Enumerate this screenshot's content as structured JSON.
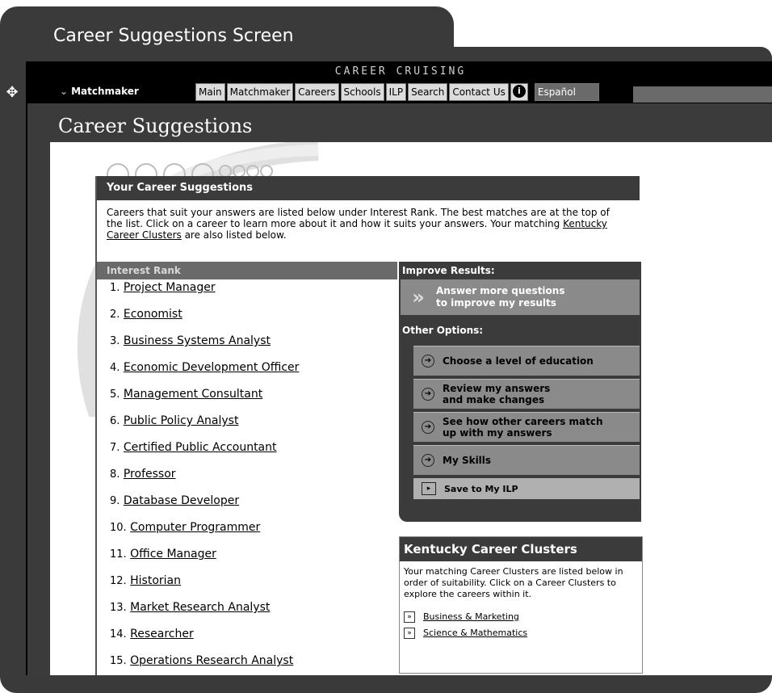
{
  "caption": "Career Suggestions Screen",
  "app": {
    "brand": "CAREER CRUISING",
    "section": "Matchmaker",
    "menu": [
      "Main",
      "Matchmaker",
      "Careers",
      "Schools",
      "ILP",
      "Search",
      "Contact Us"
    ],
    "language": "Español",
    "info_icon": "i"
  },
  "page_title": "Career Suggestions",
  "card": {
    "title": "Your Career Suggestions",
    "intro_pre": "Careers that suit your answers are listed below under Interest Rank. The best matches are at the top of the list. Click on a career to learn more about it and how it suits your answers.  Your matching ",
    "intro_link": "Kentucky Career Clusters",
    "intro_post": " are also listed below."
  },
  "rank": {
    "header": "Interest Rank",
    "items": [
      {
        "num": "1.",
        "label": "Project Manager"
      },
      {
        "num": "2.",
        "label": "Economist"
      },
      {
        "num": "3.",
        "label": "Business Systems Analyst"
      },
      {
        "num": "4.",
        "label": "Economic Development Officer"
      },
      {
        "num": "5.",
        "label": "Management Consultant"
      },
      {
        "num": "6.",
        "label": "Public Policy Analyst"
      },
      {
        "num": "7.",
        "label": "Certified Public Accountant"
      },
      {
        "num": "8.",
        "label": "Professor"
      },
      {
        "num": "9.",
        "label": "Database Developer"
      },
      {
        "num": "10.",
        "label": "Computer Programmer"
      },
      {
        "num": "11.",
        "label": "Office Manager"
      },
      {
        "num": "12.",
        "label": "Historian"
      },
      {
        "num": "13.",
        "label": "Market Research Analyst"
      },
      {
        "num": "14.",
        "label": "Researcher"
      },
      {
        "num": "15.",
        "label": "Operations Research Analyst"
      }
    ]
  },
  "sidebar": {
    "improve_label": "Improve Results:",
    "improve_btn_line1": "Answer more questions",
    "improve_btn_line2": "to improve my results",
    "other_label": "Other Options:",
    "options": [
      {
        "line1": "Choose a level of education",
        "line2": ""
      },
      {
        "line1": "Review my answers",
        "line2": "and make changes"
      },
      {
        "line1": "See how other careers match",
        "line2": "up with my answers"
      },
      {
        "line1": "My Skills",
        "line2": ""
      }
    ],
    "save_label": "Save to My ILP"
  },
  "clusters": {
    "title": "Kentucky Career Clusters",
    "description": "Your matching Career Clusters are listed below in order of suitability. Click on a Career Clusters to explore the careers within it.",
    "items": [
      "Business & Marketing",
      "Science & Mathematics"
    ]
  },
  "icons": {
    "move": "move-arrows-icon",
    "section": "double-chevron-down-icon",
    "improve": "double-chevron-right-icon",
    "option": "circle-arrow-right-icon",
    "save": "folder-icon",
    "cluster": "boxed-chevron-icon"
  }
}
